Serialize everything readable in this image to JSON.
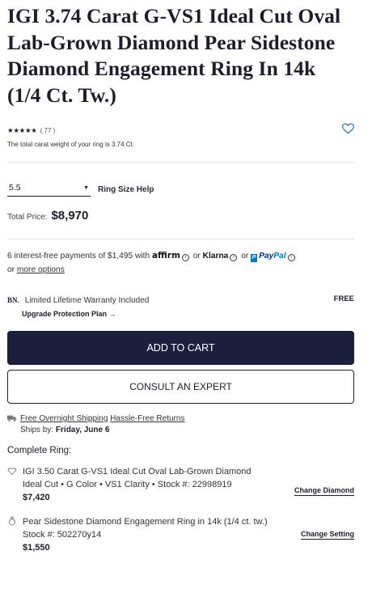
{
  "product": {
    "title": "IGI 3.74 Carat G-VS1 Ideal Cut Oval Lab-Grown Diamond Pear Sidestone Diamond Engagement Ring In 14k (1/4 Ct. Tw.)",
    "stars": "★★★★★",
    "rating_count": "( 77 )",
    "carat_note": "The total carat weight of your ring is 3.74 Ct."
  },
  "size": {
    "value": "5.5",
    "help_label": "Ring Size Help"
  },
  "price": {
    "label": "Total Price:",
    "amount": "$8,970"
  },
  "financing": {
    "prefix": "6 interest-free payments of $1,495 with",
    "affirm": "affirm",
    "or1": "or",
    "klarna": "Klarna",
    "or2": "or",
    "paypal_a": "Pay",
    "paypal_b": "Pal",
    "or3": "or",
    "more_options": "more options"
  },
  "warranty": {
    "logo": "BN.",
    "label": "Limited Lifetime Warranty Included",
    "free": "FREE",
    "upgrade": "Upgrade Protection Plan  →"
  },
  "buttons": {
    "add_to_cart": "ADD TO CART",
    "consult": "CONSULT AN EXPERT"
  },
  "shipping": {
    "free_overnight": "Free Overnight Shipping",
    "hassle_free": "Hassle-Free Returns",
    "ships_by_label": "Ships by:",
    "ships_by_date": "Friday, June 6"
  },
  "complete_ring": {
    "title": "Complete Ring:",
    "diamond": {
      "icon": "diamond-outline-icon",
      "name": "IGI 3.50 Carat G-VS1 Ideal Cut Oval Lab-Grown Diamond",
      "details": "Ideal Cut • G Color • VS1 Clarity • Stock #: 22998919",
      "price": "$7,420",
      "change": "Change Diamond"
    },
    "setting": {
      "icon": "ring-icon",
      "name": "Pear Sidestone Diamond Engagement Ring in 14k (1/4 ct. tw.)",
      "details": "Stock #: 502270y14",
      "price": "$1,550",
      "change": "Change Setting"
    }
  },
  "colors": {
    "primary": "#1b1f3b",
    "accent_blue": "#2a6fd6"
  }
}
